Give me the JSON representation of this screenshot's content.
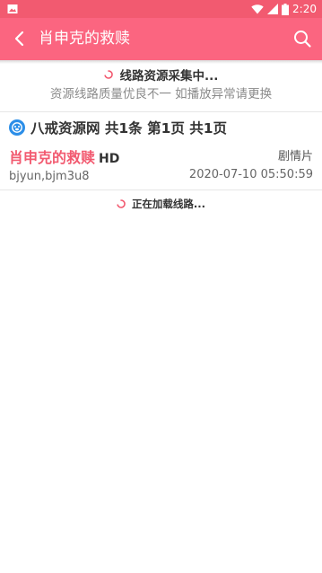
{
  "status_bar": {
    "time": "2:20",
    "icons": [
      "image-icon",
      "wifi-icon",
      "signal-icon",
      "battery-icon"
    ]
  },
  "app_bar": {
    "title": "肖申克的救赎",
    "back_icon": "chevron-left-icon",
    "search_icon": "search-icon",
    "color": "#fb6580"
  },
  "collect_notice": {
    "status": "线路资源采集中...",
    "hint": "资源线路质量优良不一 如播放异常请更换"
  },
  "source": {
    "header": "八戒资源网 共1条 第1页 共1页",
    "icon": "bajie-source-icon"
  },
  "results": [
    {
      "title": "肖申克的救赎",
      "quality": "HD",
      "genre": "剧情片",
      "tags": "bjyun,bjm3u8",
      "updated": "2020-07-10 05:50:59"
    }
  ],
  "loading": {
    "text": "正在加载线路..."
  },
  "colors": {
    "accent": "#fb6580",
    "title_red": "#f25a70",
    "source_blue": "#2b8ee8"
  }
}
